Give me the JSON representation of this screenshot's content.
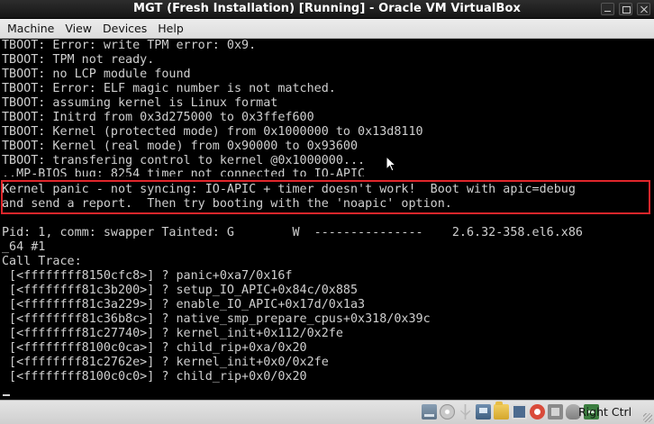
{
  "window": {
    "title": "MGT (Fresh Installation) [Running] - Oracle VM VirtualBox"
  },
  "menubar": {
    "items": [
      "Machine",
      "View",
      "Devices",
      "Help"
    ]
  },
  "console": {
    "lines": [
      "TBOOT: Error: write TPM error: 0x9.",
      "TBOOT: TPM not ready.",
      "TBOOT: no LCP module found",
      "TBOOT: Error: ELF magic number is not matched.",
      "TBOOT: assuming kernel is Linux format",
      "TBOOT: Initrd from 0x3d275000 to 0x3ffef600",
      "TBOOT: Kernel (protected mode) from 0x1000000 to 0x13d8110",
      "TBOOT: Kernel (real mode) from 0x90000 to 0x93600",
      "TBOOT: transfering control to kernel @0x1000000...",
      "..MP-BIOS bug: 8254 timer not connected to IO-APIC",
      "Kernel panic - not syncing: IO-APIC + timer doesn't work!  Boot with apic=debug",
      "and send a report.  Then try booting with the 'noapic' option.",
      "",
      "Pid: 1, comm: swapper Tainted: G        W  ---------------    2.6.32-358.el6.x86",
      "_64 #1",
      "Call Trace:",
      " [<ffffffff8150cfc8>] ? panic+0xa7/0x16f",
      " [<ffffffff81c3b200>] ? setup_IO_APIC+0x84c/0x885",
      " [<ffffffff81c3a229>] ? enable_IO_APIC+0x17d/0x1a3",
      " [<ffffffff81c36b8c>] ? native_smp_prepare_cpus+0x318/0x39c",
      " [<ffffffff81c27740>] ? kernel_init+0x112/0x2fe",
      " [<ffffffff8100c0ca>] ? child_rip+0xa/0x20",
      " [<ffffffff81c2762e>] ? kernel_init+0x0/0x2fe",
      " [<ffffffff8100c0c0>] ? child_rip+0x0/0x20"
    ]
  },
  "statusbar": {
    "host_key": "Right Ctrl",
    "icons": [
      "hard-disk-icon",
      "optical-drive-icon",
      "usb-icon",
      "network-icon",
      "shared-folders-icon",
      "display-icon",
      "video-capture-icon",
      "cpu-icon",
      "mouse-integration-icon",
      "keyboard-capture-icon"
    ]
  },
  "colors": {
    "panel_highlight": "#e0262b",
    "console_text": "#cfcfcf",
    "console_bg": "#000000"
  }
}
